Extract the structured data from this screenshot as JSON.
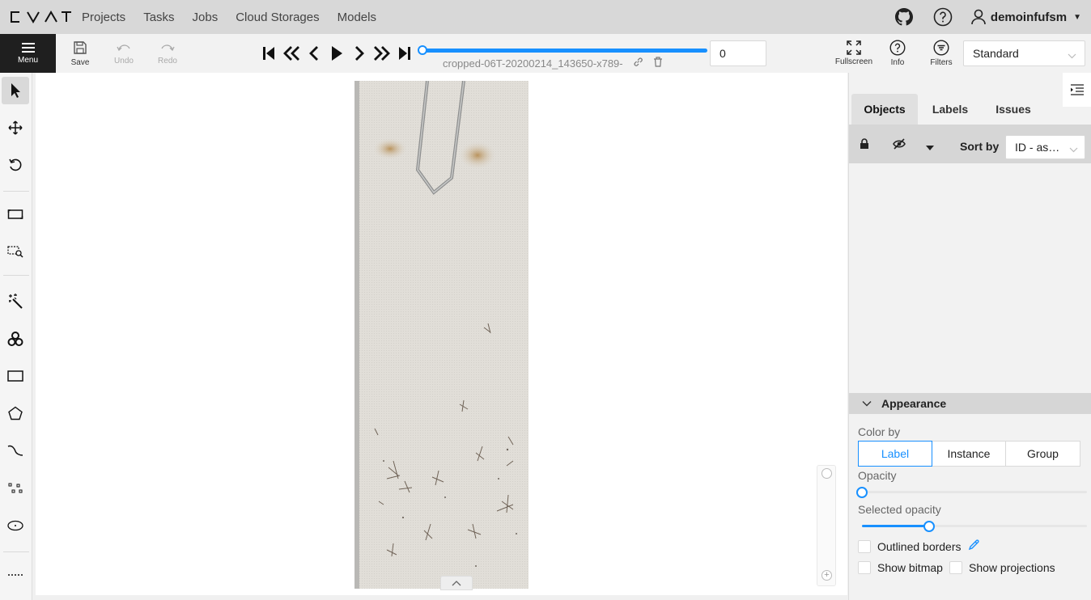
{
  "app": {
    "logo_text": "CVAT"
  },
  "nav": {
    "links": [
      "Projects",
      "Tasks",
      "Jobs",
      "Cloud Storages",
      "Models"
    ]
  },
  "user": {
    "name": "demoinfufsm"
  },
  "toolbar": {
    "menu_label": "Menu",
    "save_label": "Save",
    "undo_label": "Undo",
    "redo_label": "Redo",
    "filename": "cropped-06T-20200214_143650-x789-",
    "frame_number": "0",
    "fullscreen_label": "Fullscreen",
    "info_label": "Info",
    "filters_label": "Filters",
    "workspace": "Standard"
  },
  "right_panel": {
    "tabs": [
      "Objects",
      "Labels",
      "Issues"
    ],
    "sort_by_label": "Sort by",
    "sort_by_value": "ID - as…",
    "appearance": {
      "title": "Appearance",
      "color_by_label": "Color by",
      "color_by_options": [
        "Label",
        "Instance",
        "Group"
      ],
      "color_by_selected": "Label",
      "opacity_label": "Opacity",
      "opacity_value": 0.0,
      "selected_opacity_label": "Selected opacity",
      "selected_opacity_value": 0.3,
      "outlined_borders_label": "Outlined borders",
      "show_bitmap_label": "Show bitmap",
      "show_projections_label": "Show projections"
    }
  },
  "colors": {
    "accent": "#1890ff",
    "menu_bg": "#1f1f1f"
  }
}
